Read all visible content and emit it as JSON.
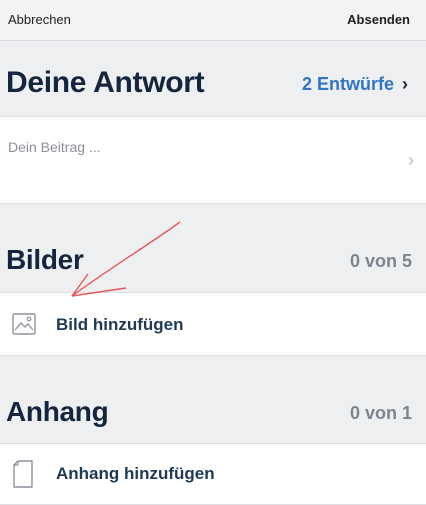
{
  "topbar": {
    "cancel_label": "Abbrechen",
    "send_label": "Absenden"
  },
  "reply": {
    "title": "Deine Antwort",
    "drafts_label": "2 Entwürfe",
    "placeholder": "Dein Beitrag ..."
  },
  "images": {
    "title": "Bilder",
    "count": "0 von 5",
    "add_label": "Bild hinzufügen"
  },
  "attachment": {
    "title": "Anhang",
    "count": "0 von 1",
    "add_label": "Anhang hinzufügen"
  },
  "colors": {
    "accent": "#2f75c8",
    "heading": "#14253d",
    "count": "#7d8591",
    "annotation": "#e35a5a"
  },
  "icons": {
    "drafts_chevron": "chevron-right-icon",
    "row_chevron": "chevron-right-icon",
    "image": "image-icon",
    "file": "file-icon"
  }
}
